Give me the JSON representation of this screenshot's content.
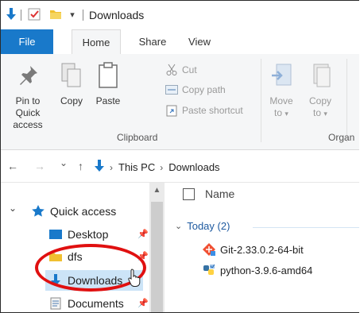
{
  "window": {
    "title": "Downloads",
    "qat_dropdown_glyph": "▾"
  },
  "ribbon_tabs": [
    "File",
    "Home",
    "Share",
    "View"
  ],
  "clipboard": {
    "pin_label_line1": "Pin to Quick",
    "pin_label_line2": "access",
    "copy_label": "Copy",
    "paste_label": "Paste",
    "cut_label": "Cut",
    "copy_path_label": "Copy path",
    "paste_shortcut_label": "Paste shortcut",
    "group_label": "Clipboard"
  },
  "organize": {
    "move_to_line1": "Move",
    "move_to_line2": "to",
    "copy_to_line1": "Copy",
    "copy_to_line2": "to",
    "dropdown_glyph": "▾",
    "group_label": "Organ"
  },
  "address_bar": {
    "back_glyph": "←",
    "forward_glyph": "→",
    "recent_glyph": "⌄",
    "up_glyph": "↑",
    "separator_glyph": "›",
    "crumbs": [
      "This PC",
      "Downloads"
    ]
  },
  "nav_pane": {
    "expand_glyph": "⌄",
    "scroll_up_glyph": "▲",
    "pin_glyph": "📌",
    "items": [
      {
        "label": "Quick access",
        "icon": "star-icon"
      },
      {
        "label": "Desktop",
        "icon": "desktop-folder-icon"
      },
      {
        "label": "dfs",
        "icon": "folder-icon"
      },
      {
        "label": "Downloads",
        "icon": "downloads-folder-icon"
      },
      {
        "label": "Documents",
        "icon": "documents-folder-icon"
      }
    ]
  },
  "file_list": {
    "column_name": "Name",
    "group_chevron": "⌄",
    "group_label": "Today (2)",
    "files": [
      {
        "name": "Git-2.33.0.2-64-bit",
        "icon": "git-installer-icon"
      },
      {
        "name": "python-3.9.6-amd64",
        "icon": "python-installer-icon"
      }
    ]
  },
  "colors": {
    "accent": "#1979ca",
    "highlight_ring": "#e01010",
    "selection": "#cce4f7"
  }
}
